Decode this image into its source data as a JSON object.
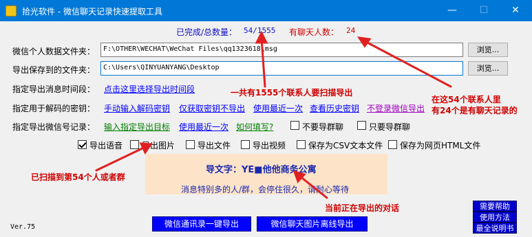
{
  "window": {
    "title": "拾光软件 - 微信聊天记录快速提取工具",
    "min_symbol": "—",
    "max_symbol": "☐",
    "close_symbol": "✕",
    "icon": "app-icon"
  },
  "status": {
    "progress_label": "已完成/总数量：",
    "progress_value": "54/1555",
    "chat_count_label": "有聊天人数：",
    "chat_count_value": "24"
  },
  "rows": {
    "data_folder_label": "微信个人数据文件夹：",
    "data_folder_value": "F:\\OTHER\\WECHAT\\WeChat Files\\qq1323618\\msg",
    "export_folder_label": "导出保存到的文件夹：",
    "export_folder_value": "C:\\Users\\QINYUANYANG\\Desktop",
    "browse_label": "浏览...",
    "time_range_label": "指定导出消息时间段：",
    "time_range_link": "点击这里选择导出时间段",
    "decrypt_key_label": "指定用于解码的密钥：",
    "decrypt_links": [
      "手动输入解码密钥",
      "仅获取密钥不导出",
      "使用最近一次",
      "查看历史密钥",
      "不登录微信导出"
    ],
    "wechat_id_label": "指定导出微信号记录：",
    "wechat_links": [
      "输入指定导出目标",
      "使用最近一次",
      "如何填写?"
    ],
    "group_options": [
      "不要导群聊",
      "只要导群聊"
    ]
  },
  "export_options": [
    {
      "label": "导出语音",
      "checked": true
    },
    {
      "label": "导出图片",
      "checked": false
    },
    {
      "label": "导出文件",
      "checked": false
    },
    {
      "label": "导出视频",
      "checked": false
    },
    {
      "label": "保存为CSV文本文件",
      "checked": false
    },
    {
      "label": "保存为网页HTML文件",
      "checked": false
    }
  ],
  "ad": {
    "title": "导文字：YE■他他商务公寓",
    "status": "消息特别多的人/群，会停住很久，请耐心等待"
  },
  "footer": {
    "version": "Ver.75",
    "export_contacts_button": "微信通讯录一键导出",
    "export_images_button": "微信聊天图片离线导出",
    "help_buttons": [
      "需要帮助",
      "使用方法",
      "最全说明书"
    ]
  },
  "annotations": {
    "total": "一共有1555个联系人要扫描导出",
    "chat_line1": "在这54个联系人里",
    "chat_line2": "有24个是有聊天记录的",
    "scanned": "已扫描到第54个人或者群",
    "current": "当前正在导出的对话"
  },
  "colors": {
    "titlebar": "#0078d7",
    "annotation": "#d00000",
    "status_blue": "#1010c0",
    "ad_background": "#fde3c8",
    "action_button": "#0000ff"
  }
}
